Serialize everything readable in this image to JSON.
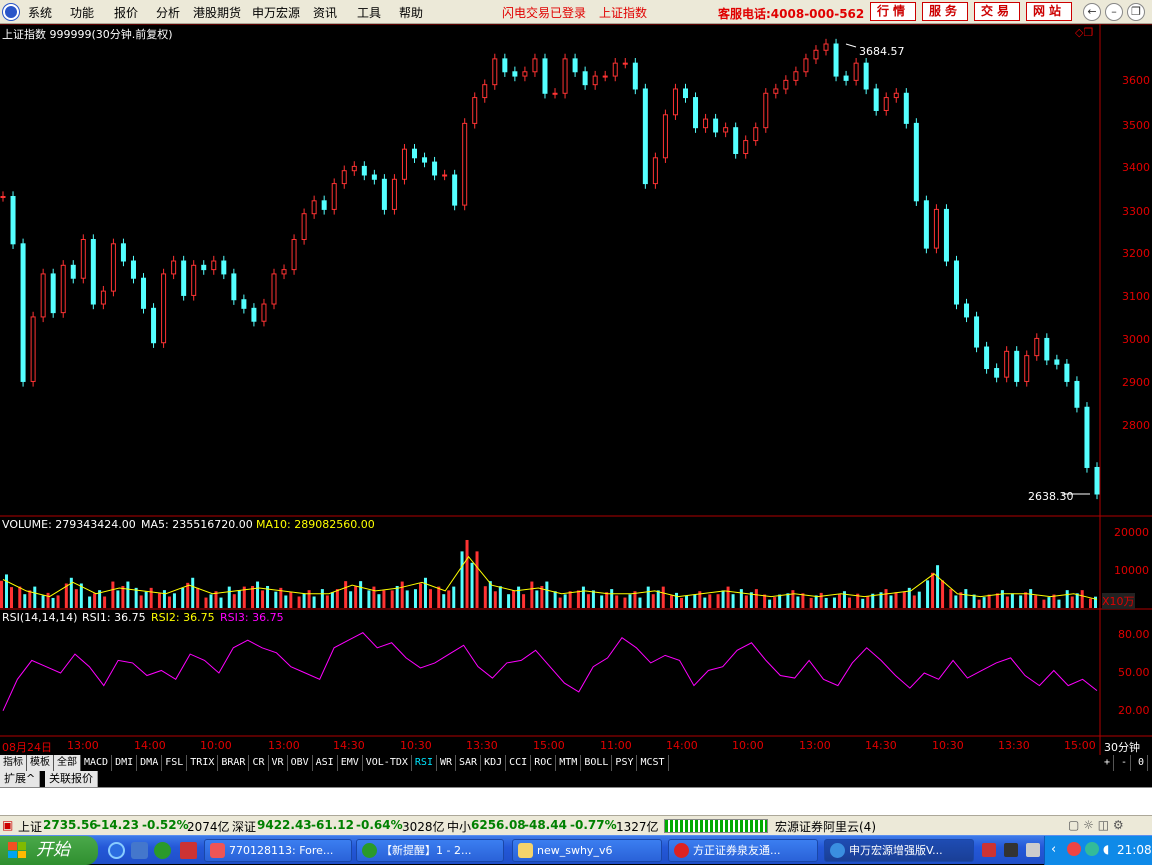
{
  "menubar": {
    "items": [
      "系统",
      "功能",
      "报价",
      "分析",
      "港股期货",
      "申万宏源",
      "资讯",
      "工具",
      "帮助"
    ],
    "status": "闪电交易已登录",
    "index_name": "上证指数",
    "hotline": "客服电话:4008-000-562",
    "buttons": [
      "行情",
      "服务",
      "交易",
      "网站"
    ],
    "window_controls": [
      "←",
      "–",
      "❐",
      "×"
    ]
  },
  "chart": {
    "title": "上证指数 999999(30分钟.前复权)",
    "high_label": "3684.57",
    "low_label": "2638.30",
    "price_ticks": [
      "3600",
      "3500",
      "3400",
      "3300",
      "3200",
      "3100",
      "3000",
      "2900",
      "2800"
    ],
    "volume_header": {
      "label": "VOLUME: 279343424.00",
      "ma5": "MA5: 235516720.00",
      "ma10": "MA10: 289082560.00"
    },
    "volume_ticks": [
      "20000",
      "10000"
    ],
    "volume_unit": "X10万",
    "rsi_header": {
      "label": "RSI(14,14,14)",
      "rsi1": "RSI1: 36.75",
      "rsi2": "RSI2: 36.75",
      "rsi3": "RSI3: 36.75"
    },
    "rsi_ticks": [
      "80.00",
      "50.00",
      "20.00"
    ],
    "time_ticks": [
      "08月24日",
      "13:00",
      "14:00",
      "10:00",
      "13:00",
      "14:30",
      "10:30",
      "13:30",
      "15:00",
      "11:00",
      "14:00",
      "10:00",
      "13:00",
      "14:30",
      "10:30",
      "13:30",
      "15:00"
    ],
    "period": "30分钟"
  },
  "chart_data": {
    "type": "line",
    "series": [
      {
        "name": "上证指数",
        "y_range": [
          2638.3,
          3684.57
        ],
        "values": [
          3330,
          3220,
          2900,
          3050,
          3150,
          3060,
          3170,
          3140,
          3230,
          3080,
          3110,
          3220,
          3180,
          3140,
          3070,
          2990,
          3150,
          3180,
          3100,
          3170,
          3160,
          3180,
          3150,
          3090,
          3070,
          3040,
          3080,
          3150,
          3160,
          3230,
          3290,
          3320,
          3300,
          3360,
          3390,
          3400,
          3380,
          3370,
          3300,
          3370,
          3440,
          3420,
          3410,
          3380,
          3380,
          3310,
          3500,
          3560,
          3590,
          3650,
          3620,
          3610,
          3620,
          3650,
          3570,
          3570,
          3650,
          3620,
          3590,
          3610,
          3610,
          3640,
          3640,
          3580,
          3360,
          3420,
          3520,
          3580,
          3560,
          3490,
          3510,
          3480,
          3490,
          3430,
          3460,
          3490,
          3570,
          3580,
          3600,
          3620,
          3650,
          3670,
          3684.57,
          3610,
          3600,
          3640,
          3580,
          3530,
          3560,
          3570,
          3500,
          3320,
          3210,
          3300,
          3180,
          3080,
          3050,
          2980,
          2930,
          2910,
          2970,
          2900,
          2960,
          3000,
          2950,
          2940,
          2900,
          2840,
          2700,
          2638.3
        ]
      },
      {
        "name": "RSI1",
        "y_range": [
          0,
          100
        ],
        "values": [
          20,
          45,
          60,
          55,
          50,
          65,
          55,
          40,
          60,
          58,
          48,
          52,
          45,
          65,
          60,
          50,
          70,
          76,
          70,
          66,
          55,
          50,
          45,
          70,
          76,
          82,
          70,
          74,
          62,
          54,
          58,
          65,
          72,
          55,
          46,
          58,
          60,
          68,
          55,
          42,
          35,
          55,
          62,
          78,
          70,
          58,
          64,
          60,
          40,
          52,
          55,
          68,
          74,
          60,
          48,
          46,
          60,
          45,
          40,
          58,
          70,
          60,
          48,
          38,
          50,
          45,
          60,
          46,
          52,
          58,
          62,
          48,
          40,
          52,
          40,
          45,
          36
        ]
      },
      {
        "name": "VOLUME",
        "unit": "X10万",
        "values": [
          10000,
          6000,
          4000,
          9000,
          5000,
          7000,
          6000,
          5000,
          8000,
          5000,
          6000,
          7000,
          6000,
          5000,
          5000,
          8000,
          6000,
          7000,
          9000,
          6000,
          18000,
          8000,
          6000,
          7000,
          5000,
          6000,
          5000,
          5000,
          6000,
          4000,
          5000,
          6000,
          5000,
          4000,
          5000,
          4000,
          5000,
          4000,
          5000,
          6000,
          12000,
          5000,
          4000,
          5000,
          5000,
          4000,
          5000,
          3000
        ]
      }
    ]
  },
  "tabs": [
    "指标",
    "模板",
    "全部",
    "MACD",
    "DMI",
    "DMA",
    "FSL",
    "TRIX",
    "BRAR",
    "CR",
    "VR",
    "OBV",
    "ASI",
    "EMV",
    "VOL-TDX",
    "RSI",
    "WR",
    "SAR",
    "KDJ",
    "CCI",
    "ROC",
    "MTM",
    "BOLL",
    "PSY",
    "MCST"
  ],
  "tab_controls": [
    "+",
    "-",
    "0"
  ],
  "subtabs": [
    "扩展^",
    "关联报价"
  ],
  "statusbar": {
    "sh_label": "上证",
    "sh_value": "2735.56",
    "sh_change": "-14.23",
    "sh_pct": "-0.52%",
    "sh_amount": "2074亿",
    "sz_label": "深证",
    "sz_value": "9422.43",
    "sz_change": "-61.12",
    "sz_pct": "-0.64%",
    "sz_amount": "3028亿",
    "zx_label": "中小",
    "zx_value": "6256.08",
    "zx_change": "-48.44",
    "zx_pct": "-0.77%",
    "zx_amount": "1327亿",
    "server": "宏源证券阿里云(4)"
  },
  "taskbar": {
    "start": "开始",
    "windows": [
      {
        "label": "770128113: Fore..."
      },
      {
        "label": "【新提醒】1 - 2..."
      },
      {
        "label": "new_swhy_v6"
      },
      {
        "label": "方正证券泉友通..."
      },
      {
        "label": "申万宏源增强版V..."
      }
    ],
    "clock": "21:08"
  }
}
